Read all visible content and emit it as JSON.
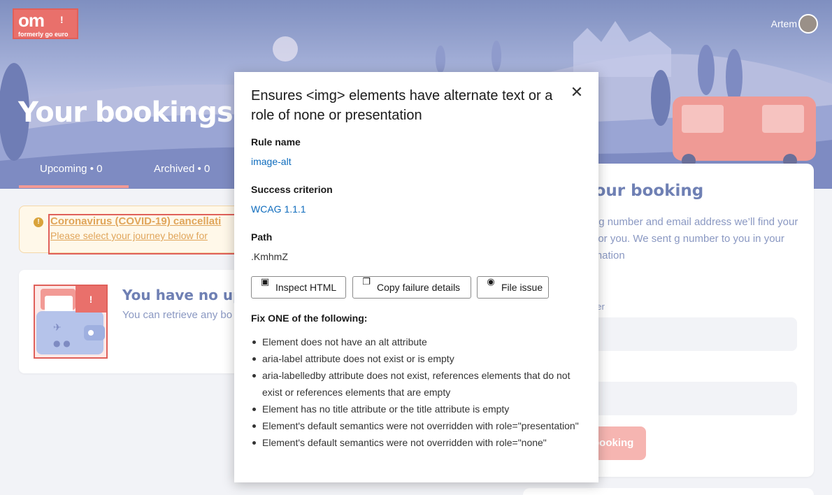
{
  "header": {
    "logo_text": "om",
    "logo_subtext": "formerly go euro",
    "logo_flag": "!",
    "user_name": "Artem"
  },
  "page": {
    "title": "Your bookings",
    "tabs": [
      {
        "label": "Upcoming • 0",
        "active": true
      },
      {
        "label": "Archived • 0",
        "active": false
      }
    ]
  },
  "covid_notice": {
    "icon": "info-icon",
    "title": "Coronavirus (COVID-19) cancellati",
    "text": "Please select your journey below for"
  },
  "empty_state": {
    "flag": "!",
    "heading": "You have no upco",
    "text": "You can retrieve any bo"
  },
  "find_booking": {
    "heading": "e your booking",
    "text": "booking number and email address we’ll find your ticket for you. We sent g number to you in your confirmation",
    "field1_label": "ber",
    "field2_label": "s",
    "button_label": "booking"
  },
  "accessibility_dialog": {
    "title": "Ensures <img> elements have alternate text or a role of none or presentation",
    "rule_name_label": "Rule name",
    "rule_name": "image-alt",
    "success_criterion_label": "Success criterion",
    "success_criterion": "WCAG 1.1.1",
    "path_label": "Path",
    "path": ".KmhmZ",
    "buttons": {
      "inspect": "Inspect HTML",
      "copy": "Copy failure details",
      "file": "File issue"
    },
    "fix_heading": "Fix ONE of the following:",
    "fixes": [
      "Element does not have an alt attribute",
      "aria-label attribute does not exist or is empty",
      "aria-labelledby attribute does not exist, references elements that do not exist or references elements that are empty",
      "Element has no title attribute or the title attribute is empty",
      "Element's default semantics were not overridden with role=\"presentation\"",
      "Element's default semantics were not overridden with role=\"none\""
    ]
  },
  "colors": {
    "brand": "#e9706b",
    "highlight_border": "#e0605a",
    "link": "#0f6cbd",
    "heading_blue": "#6f80b4"
  }
}
